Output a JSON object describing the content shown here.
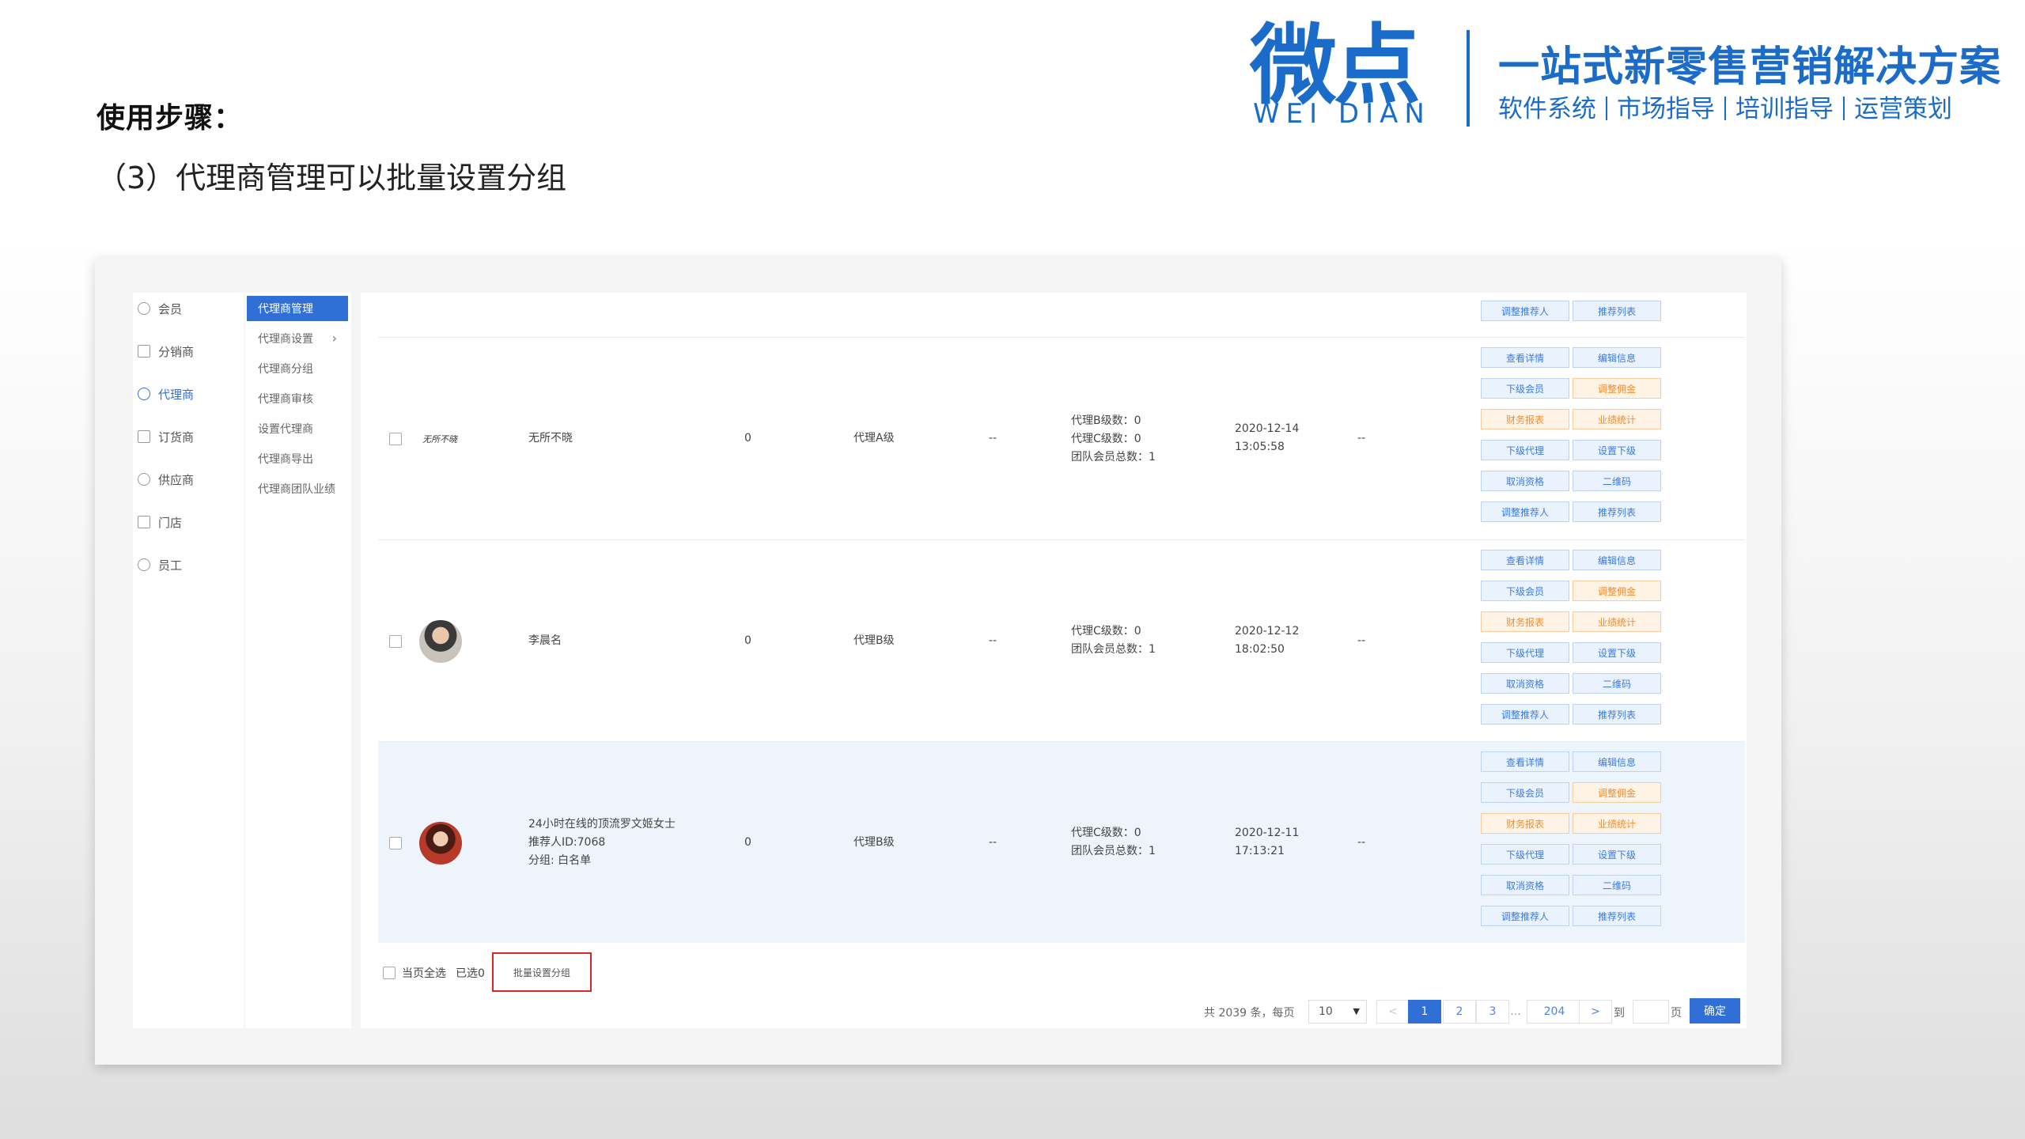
{
  "slide": {
    "steps_label": "使用步骤：",
    "subtitle": "（3）代理商管理可以批量设置分组"
  },
  "brand": {
    "logo_cn": "微点",
    "logo_en": "WEI DIAN",
    "tagline": "一站式新零售营销解决方案",
    "tagline_items": [
      "软件系统",
      "市场指导",
      "培训指导",
      "运营策划"
    ],
    "color": "#1a6cc8"
  },
  "sidebar": {
    "items": [
      {
        "label": "会员",
        "icon": "user-icon"
      },
      {
        "label": "分销商",
        "icon": "distributor-icon"
      },
      {
        "label": "代理商",
        "icon": "agent-icon",
        "active": true
      },
      {
        "label": "订货商",
        "icon": "order-icon"
      },
      {
        "label": "供应商",
        "icon": "supplier-icon"
      },
      {
        "label": "门店",
        "icon": "store-icon"
      },
      {
        "label": "员工",
        "icon": "staff-icon"
      }
    ]
  },
  "submenu": {
    "items": [
      {
        "label": "代理商管理",
        "active": true
      },
      {
        "label": "代理商设置",
        "has_children": true
      },
      {
        "label": "代理商分组"
      },
      {
        "label": "代理商审核"
      },
      {
        "label": "设置代理商"
      },
      {
        "label": "代理商导出"
      },
      {
        "label": "代理商团队业绩"
      }
    ]
  },
  "actions": {
    "view_detail": "查看详情",
    "edit_info": "编辑信息",
    "sub_members": "下级会员",
    "adjust_commission": "调整佣金",
    "finance_report": "财务报表",
    "performance": "业绩统计",
    "sub_agents": "下级代理",
    "set_sub": "设置下级",
    "cancel_qualification": "取消资格",
    "qrcode": "二维码",
    "adjust_referrer": "调整推荐人",
    "referral_list": "推荐列表"
  },
  "rows": [
    {
      "avatar": "signature",
      "avatar_text": "无所不晓",
      "name_lines": [
        "无所不晓"
      ],
      "count": "0",
      "level": "代理A级",
      "dash1": "--",
      "stats": [
        "代理B级数：0",
        "代理C级数：0",
        "团队会员总数：1"
      ],
      "date": "2020-12-14",
      "time": "13:05:58",
      "dash2": "--"
    },
    {
      "avatar": "photo",
      "name_lines": [
        "李晨名"
      ],
      "count": "0",
      "level": "代理B级",
      "dash1": "--",
      "stats": [
        "代理C级数：0",
        "团队会员总数：1"
      ],
      "date": "2020-12-12",
      "time": "18:02:50",
      "dash2": "--"
    },
    {
      "avatar": "photo",
      "name_lines": [
        "24小时在线的顶流罗文姬女士",
        "推荐人ID:7068",
        "分组: 白名单"
      ],
      "count": "0",
      "level": "代理B级",
      "dash1": "--",
      "stats": [
        "代理C级数：0",
        "团队会员总数：1"
      ],
      "date": "2020-12-11",
      "time": "17:13:21",
      "dash2": "--"
    }
  ],
  "bulk": {
    "select_all": "当页全选",
    "selected": "已选0",
    "set_group_button": "批量设置分组",
    "highlight_color": "#d92727"
  },
  "pagination": {
    "total_text": "共 2039 条，每页",
    "page_size": "10",
    "prev": "<",
    "pages": [
      "1",
      "2",
      "3",
      "...",
      "204"
    ],
    "current": "1",
    "next": ">",
    "goto": "到",
    "unit": "页",
    "confirm": "确定"
  }
}
